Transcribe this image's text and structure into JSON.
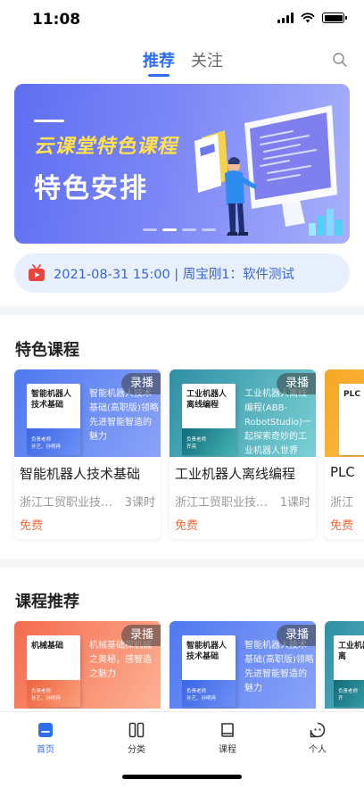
{
  "status": {
    "time": "11:08"
  },
  "top_tabs": [
    {
      "label": "推荐",
      "active": true
    },
    {
      "label": "关注",
      "active": false
    }
  ],
  "banner": {
    "subtitle": "云课堂特色课程",
    "title": "特色安排",
    "active_dot": 1
  },
  "notice": {
    "text": "2021-08-31 15:00 | 周宝刚1：软件测试",
    "icon": "tv-live-icon"
  },
  "featured": {
    "title": "特色课程",
    "cards": [
      {
        "cover_book_title": "智能机器人技术基础",
        "cover_book_meta": "负责老师\n孙艺、孙明冉",
        "cover_desc": "智能机器人技术基础(高职版)领略先进智能智造的魅力",
        "badge": "录播",
        "name": "智能机器人技术基础",
        "school": "浙江工贸职业技术学院",
        "hours": "3课时",
        "price": "免费"
      },
      {
        "cover_book_title": "工业机器人离线编程",
        "cover_book_meta": "负责老师\n齐亮",
        "cover_desc": "工业机器人离线编程(ABB-RobotStudio)一起探索奇妙的工业机器人世界吧！",
        "badge": "录播",
        "name": "工业机器人离线编程",
        "school": "浙江工贸职业技术学院",
        "hours": "1课时",
        "price": "免费"
      },
      {
        "cover_book_title": "PLC",
        "cover_book_meta": "",
        "cover_desc": "",
        "badge": "",
        "name": "PLC",
        "school": "浙江",
        "hours": "",
        "price": "免费"
      }
    ]
  },
  "recommend": {
    "title": "课程推荐",
    "cards": [
      {
        "cover_book_title": "机械基础",
        "cover_book_meta": "负责老师\n孙艺、孙明冉",
        "cover_desc": "机械基础探机械之奥秘，感智造之魅力",
        "badge": "录播"
      },
      {
        "cover_book_title": "智能机器人技术基础",
        "cover_book_meta": "负责老师\n孙艺、孙明冉",
        "cover_desc": "智能机器人技术基础(高职版)领略先进智能智造的魅力",
        "badge": "录播"
      },
      {
        "cover_book_title": "工业机器人离",
        "cover_book_meta": "负责老师\n齐",
        "cover_desc": "",
        "badge": ""
      }
    ]
  },
  "tabbar": [
    {
      "label": "首页",
      "icon": "home-icon",
      "active": true
    },
    {
      "label": "分类",
      "icon": "category-icon",
      "active": false
    },
    {
      "label": "课程",
      "icon": "book-icon",
      "active": false
    },
    {
      "label": "个人",
      "icon": "profile-icon",
      "active": false
    }
  ],
  "colors": {
    "accent": "#2e6ff1",
    "price": "#f36b3b",
    "notice_bg": "#e8effd"
  }
}
